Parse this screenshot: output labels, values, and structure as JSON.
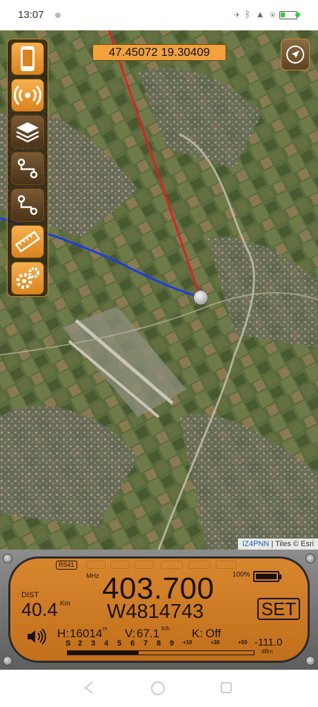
{
  "status_bar": {
    "time": "13:07"
  },
  "map": {
    "coordinates": "47.45072 19.30409",
    "attribution_link": "IZ4PNN",
    "attribution_text": " | Tiles © Esri",
    "toolbar": [
      {
        "name": "device",
        "icon": "phone-icon"
      },
      {
        "name": "signal",
        "icon": "radio-waves-icon"
      },
      {
        "name": "layers",
        "icon": "layers-icon"
      },
      {
        "name": "route",
        "icon": "route-icon"
      },
      {
        "name": "track",
        "icon": "track-icon"
      },
      {
        "name": "measure",
        "icon": "ruler-icon"
      },
      {
        "name": "settings",
        "icon": "gear-icon"
      }
    ],
    "colors": {
      "heading_line": "#e02020",
      "track_line": "#1e3de0",
      "accent": "#f0a23e"
    }
  },
  "radio": {
    "model": "RS41",
    "mhz_label": "MHz",
    "frequency": "403.700",
    "serial": "W4814743",
    "battery_label": "100%",
    "battery_level": 1.0,
    "dist_label": "DIST",
    "distance": "40.4",
    "distance_unit": "Km",
    "height_label": "H:",
    "height": "16014",
    "height_unit": "m",
    "vspeed_label": "V:",
    "vspeed": "67.1",
    "vspeed_unit": "K/h",
    "k_label": "K:",
    "k_value": "Off",
    "set_label": "SET",
    "signal_dbm": "-111.0",
    "dbm_unit": "dBm",
    "signal_level": 0.38,
    "s_scale": [
      "S",
      "2",
      "3",
      "4",
      "5",
      "6",
      "7",
      "8",
      "9",
      "+10",
      "+30",
      "+50"
    ]
  }
}
